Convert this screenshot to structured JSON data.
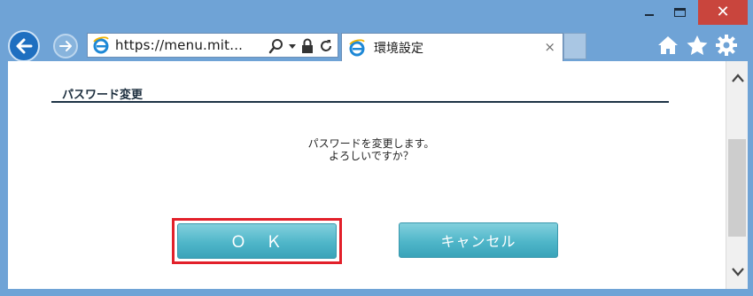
{
  "browser": {
    "address_text": "https://menu.mit...",
    "tab_title": "環境設定",
    "tab_close_label": "×",
    "window_close_label": "✕"
  },
  "dialog": {
    "section_title": "パスワード変更",
    "message_line1": "パスワードを変更します。",
    "message_line2": "よろしいですか？",
    "ok_label": "ＯＫ",
    "cancel_label": "キャンセル"
  },
  "colors": {
    "highlight_border": "#e2202a",
    "button_teal": "#4fb6c9",
    "window_frame": "#6fa3d6"
  },
  "icons": [
    "back-icon",
    "forward-icon",
    "ie-icon",
    "search-icon",
    "dropdown-icon",
    "lock-icon",
    "refresh-icon",
    "home-icon",
    "star-icon",
    "gear-icon",
    "scroll-up-icon",
    "scroll-down-icon"
  ]
}
